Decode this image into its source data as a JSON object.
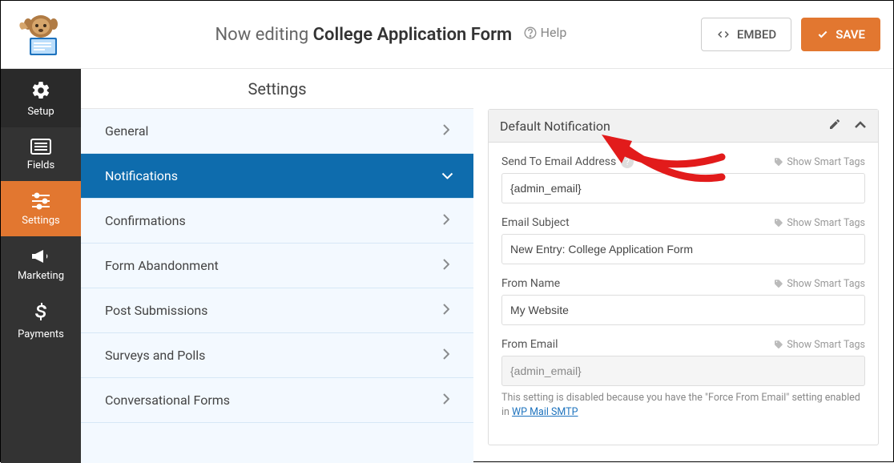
{
  "header": {
    "editing_prefix": "Now editing ",
    "form_name": "College Application Form",
    "help_label": "Help",
    "embed_label": "EMBED",
    "save_label": "SAVE"
  },
  "vside": {
    "items": [
      {
        "label": "Setup"
      },
      {
        "label": "Fields"
      },
      {
        "label": "Settings"
      },
      {
        "label": "Marketing"
      },
      {
        "label": "Payments"
      }
    ]
  },
  "subpanel": {
    "title": "Settings",
    "items": [
      {
        "label": "General"
      },
      {
        "label": "Notifications"
      },
      {
        "label": "Confirmations"
      },
      {
        "label": "Form Abandonment"
      },
      {
        "label": "Post Submissions"
      },
      {
        "label": "Surveys and Polls"
      },
      {
        "label": "Conversational Forms"
      }
    ]
  },
  "card": {
    "title": "Default Notification",
    "smart_tags_label": "Show Smart Tags",
    "fields": {
      "send_to": {
        "label": "Send To Email Address",
        "value": "{admin_email}"
      },
      "subject": {
        "label": "Email Subject",
        "value": "New Entry: College Application Form"
      },
      "from_name": {
        "label": "From Name",
        "value": "My Website"
      },
      "from_email": {
        "label": "From Email",
        "value": "{admin_email}",
        "note_prefix": "This setting is disabled because you have the \"Force From Email\" setting enabled in ",
        "note_link": "WP Mail SMTP"
      }
    }
  }
}
